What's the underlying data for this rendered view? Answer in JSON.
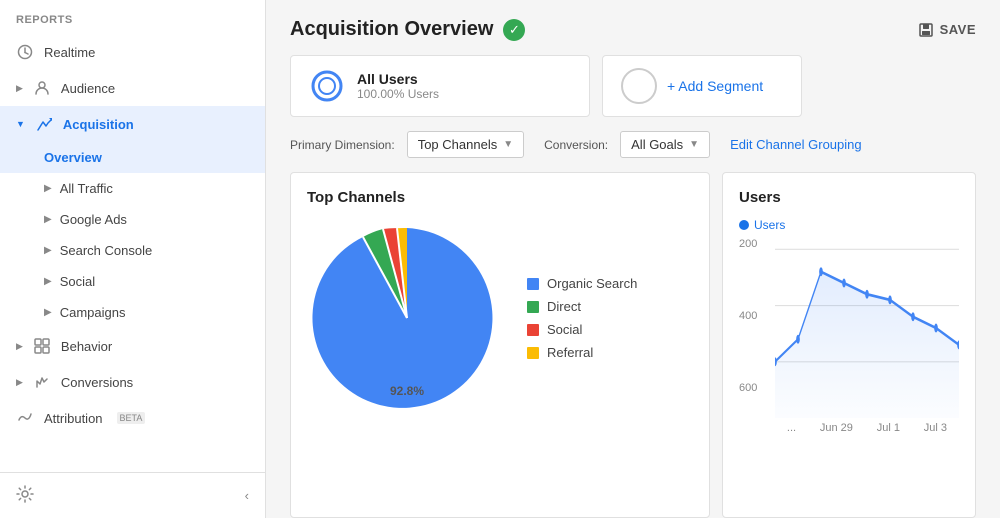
{
  "sidebar": {
    "reports_label": "REPORTS",
    "items": [
      {
        "id": "realtime",
        "label": "Realtime",
        "icon": "clock"
      },
      {
        "id": "audience",
        "label": "Audience",
        "icon": "person"
      },
      {
        "id": "acquisition",
        "label": "Acquisition",
        "icon": "arrow",
        "active": true,
        "expanded": true
      },
      {
        "id": "behavior",
        "label": "Behavior",
        "icon": "grid"
      },
      {
        "id": "conversions",
        "label": "Conversions",
        "icon": "flag"
      },
      {
        "id": "attribution",
        "label": "Attribution",
        "icon": "loop",
        "beta": true
      }
    ],
    "sub_items": [
      {
        "id": "overview",
        "label": "Overview",
        "active": true
      },
      {
        "id": "all-traffic",
        "label": "All Traffic"
      },
      {
        "id": "google-ads",
        "label": "Google Ads"
      },
      {
        "id": "search-console",
        "label": "Search Console"
      },
      {
        "id": "social",
        "label": "Social"
      },
      {
        "id": "campaigns",
        "label": "Campaigns"
      }
    ],
    "beta_label": "BETA"
  },
  "header": {
    "title": "Acquisition Overview",
    "save_label": "SAVE"
  },
  "segment": {
    "name": "All Users",
    "sub": "100.00% Users",
    "add_label": "+ Add Segment"
  },
  "dimension": {
    "primary_label": "Primary Dimension:",
    "conversion_label": "Conversion:",
    "primary_value": "Top Channels",
    "conversion_value": "All Goals",
    "edit_link": "Edit Channel Grouping"
  },
  "top_channels": {
    "title": "Top Channels",
    "legend": [
      {
        "id": "organic",
        "label": "Organic Search",
        "color": "#4285f4"
      },
      {
        "id": "direct",
        "label": "Direct",
        "color": "#34a853"
      },
      {
        "id": "social",
        "label": "Social",
        "color": "#ea4335"
      },
      {
        "id": "referral",
        "label": "Referral",
        "color": "#fbbc04"
      }
    ],
    "pie_label": "92.8%"
  },
  "users_chart": {
    "title": "Users",
    "series_label": "Users",
    "y_labels": [
      "600",
      "400",
      "200"
    ],
    "x_labels": [
      "...",
      "Jun 29",
      "Jul 1",
      "Jul 3"
    ]
  }
}
